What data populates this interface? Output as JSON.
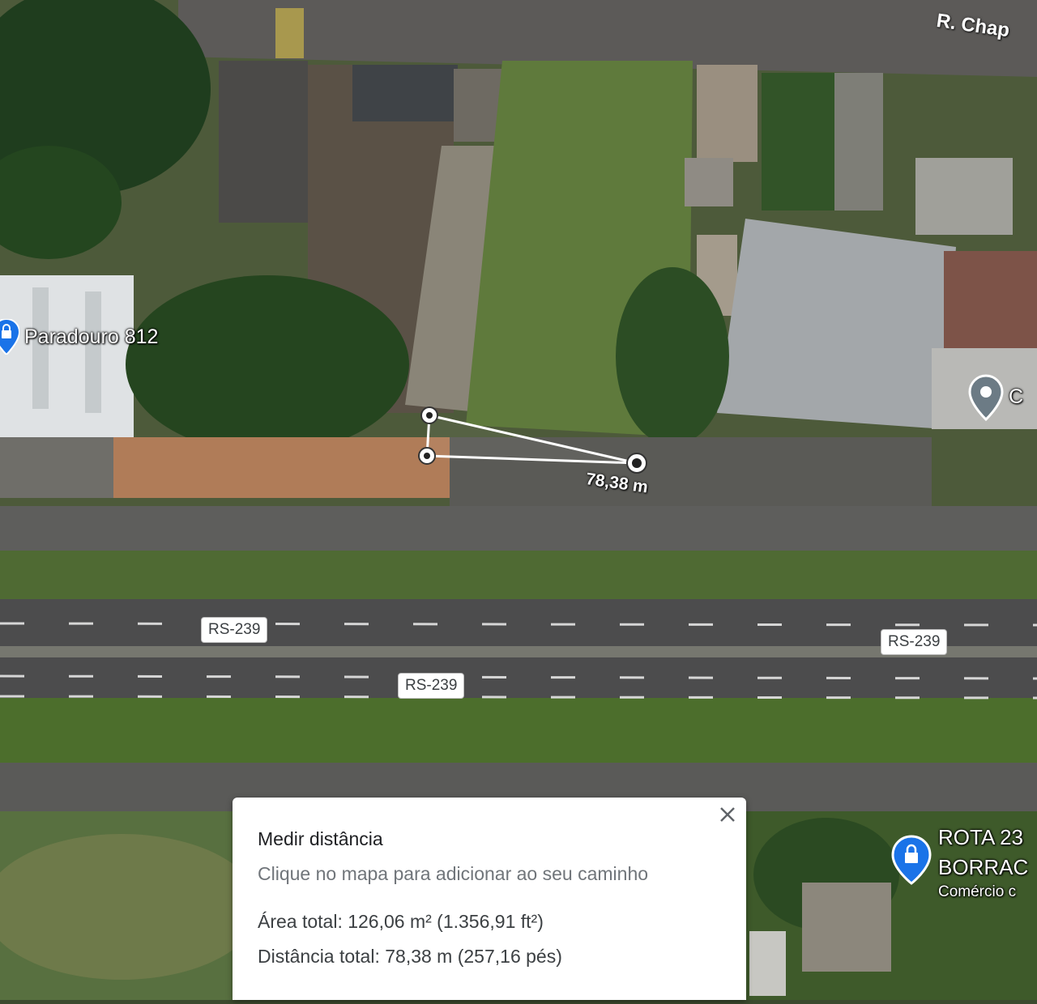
{
  "map": {
    "street_top": "R. Chap",
    "road_shields": [
      "RS-239",
      "RS-239",
      "RS-239"
    ],
    "pois": {
      "paradouro": "Paradouro 812",
      "right_pin": "C",
      "rota_line1": "ROTA 23",
      "rota_line2": "BORRAC",
      "rota_category": "Comércio c"
    },
    "measurement_label": "78,38 m"
  },
  "panel": {
    "title": "Medir distância",
    "hint": "Clique no mapa para adicionar ao seu caminho",
    "area": "Área total: 126,06 m² (1.356,91 ft²)",
    "distance": "Distância total: 78,38 m (257,16 pés)"
  },
  "colors": {
    "poi_pin": "#1a73e8",
    "right_pin": "#5f6f7a",
    "panel_bg": "#ffffff"
  },
  "icons": [
    "lock-pin-icon",
    "location-pin-icon",
    "close-icon"
  ]
}
